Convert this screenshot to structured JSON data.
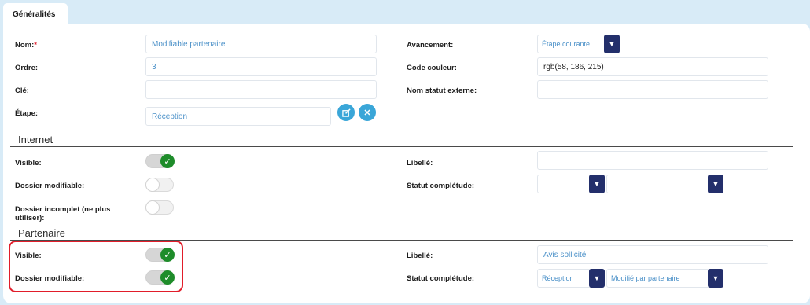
{
  "tab": {
    "label": "Généralités"
  },
  "general": {
    "nom": {
      "label": "Nom:",
      "required_mark": "*",
      "value": "Modifiable partenaire"
    },
    "ordre": {
      "label": "Ordre:",
      "value": "3"
    },
    "cle": {
      "label": "Clé:",
      "value": ""
    },
    "etape": {
      "label": "Étape:",
      "value": "Réception"
    },
    "avancement": {
      "label": "Avancement:",
      "value": "Étape courante"
    },
    "code_couleur": {
      "label": "Code couleur:",
      "value": "rgb(58, 186, 215)"
    },
    "nom_statut_externe": {
      "label": "Nom statut externe:",
      "value": ""
    }
  },
  "internet": {
    "title": "Internet",
    "visible": {
      "label": "Visible:",
      "on": true
    },
    "dossier_modifiable": {
      "label": "Dossier modifiable:",
      "on": false
    },
    "dossier_incomplet": {
      "label_line1": "Dossier incomplet (ne plus",
      "label_line2": "utiliser):",
      "on": false
    },
    "libelle": {
      "label": "Libellé:",
      "value": ""
    },
    "statut_completude": {
      "label": "Statut complétude:",
      "select1": "",
      "select2": ""
    }
  },
  "partenaire": {
    "title": "Partenaire",
    "visible": {
      "label": "Visible:",
      "on": true
    },
    "dossier_modifiable": {
      "label": "Dossier modifiable:",
      "on": true
    },
    "libelle": {
      "label": "Libellé:",
      "value": "Avis sollicité"
    },
    "statut_completude": {
      "label": "Statut complétude:",
      "select1": "Réception",
      "select2": "Modifié par partenaire"
    }
  },
  "icons": {
    "edit": "edit-icon",
    "clear": "close-icon",
    "dropdown": "caret-down-icon",
    "check": "check-icon"
  },
  "colors": {
    "accent": "#3aa6d8",
    "select_arrow": "#232f6b",
    "toggle_on": "#1e8c2a",
    "highlight": "#e11d2a",
    "required": "#e11d2a"
  }
}
